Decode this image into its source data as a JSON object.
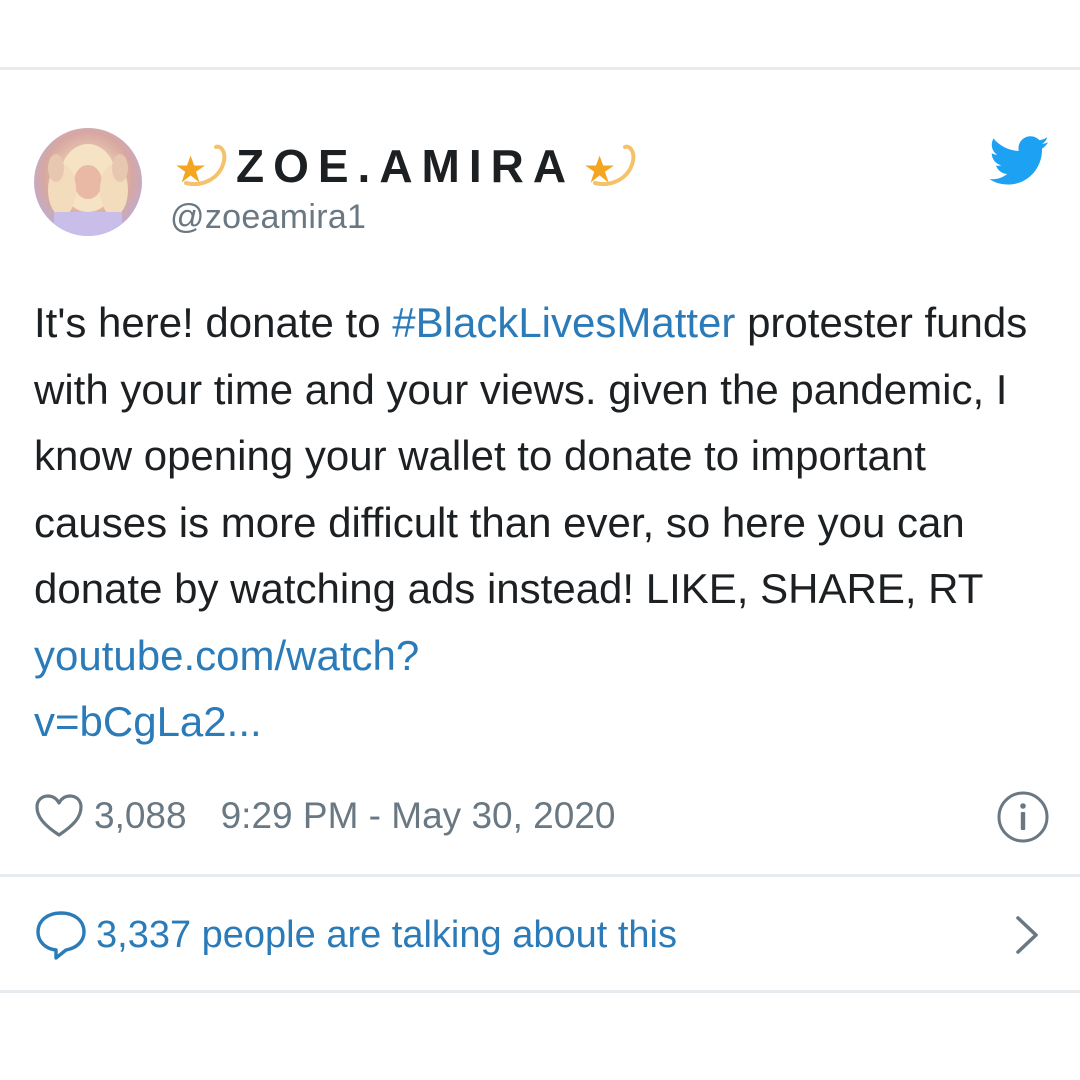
{
  "tweet": {
    "display_name": "ZOE.AMIRA",
    "handle": "@zoeamira1",
    "avatar_icon": "profile-photo",
    "platform_icon": "twitter-bird-icon",
    "accent_color": "#2b7bb9",
    "text_before_hashtag": "It's here! donate to ",
    "hashtag": "#BlackLivesMatter",
    "text_after_hashtag": " protester funds with your time and your views. given the pandemic, I know opening your wallet to donate to important causes is more difficult than ever, so here you can donate by watching ads instead! LIKE, SHARE, RT ",
    "link_line1": "youtube.com/watch?",
    "link_line2": "v=bCgLa2...",
    "like_count": "3,088",
    "timestamp": "9:29 PM - May 30, 2020",
    "talking_text": "3,337 people are talking about this"
  }
}
